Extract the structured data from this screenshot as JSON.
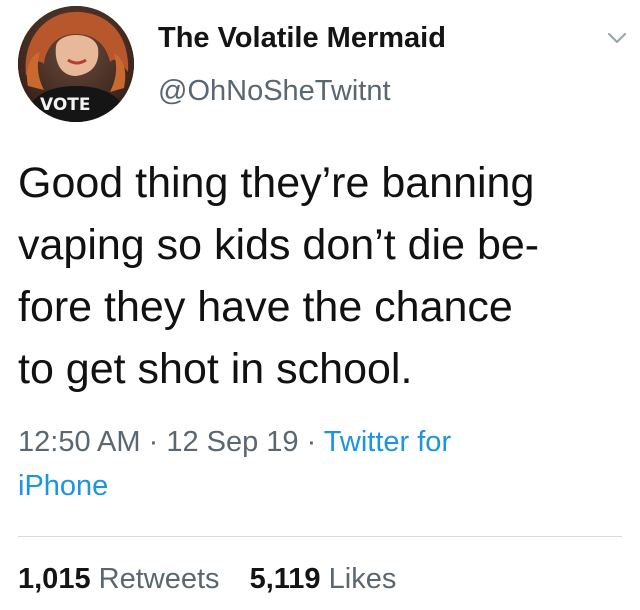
{
  "user": {
    "display_name": "The Volatile Mermaid",
    "handle": "@OhNoSheTwitnt",
    "avatar_shirt_text": "VOTE"
  },
  "tweet": {
    "lines": [
      "Good thing they’re banning",
      "vaping so kids don’t die be-",
      "fore they have the chance",
      "to get shot in school."
    ]
  },
  "meta": {
    "time": "12:50 AM",
    "separator": " · ",
    "date": "12 Sep 19",
    "source_line1": "Twitter for",
    "source_line2": "iPhone"
  },
  "stats": {
    "retweets_count": "1,015",
    "retweets_label": "Retweets",
    "likes_count": "5,119",
    "likes_label": "Likes"
  },
  "icons": {
    "menu": "chevron-down-icon",
    "avatar": "profile-photo"
  },
  "colors": {
    "link": "#1b95e0",
    "secondary_text": "#5b6770",
    "primary_text": "#141414",
    "divider": "#d6dbdf"
  }
}
